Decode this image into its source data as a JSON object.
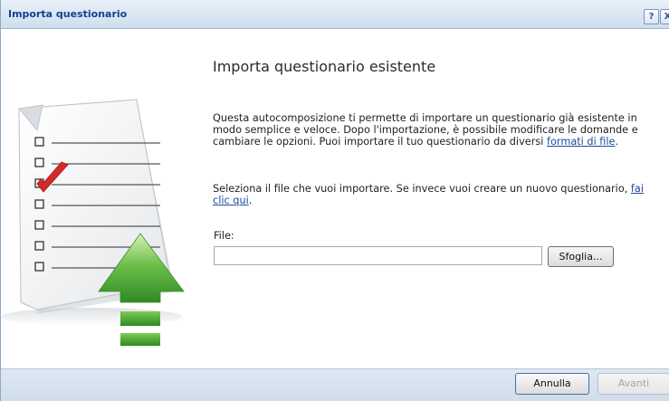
{
  "window": {
    "title": "Importa questionario",
    "help_label": "?",
    "close_label": "X"
  },
  "main": {
    "heading": "Importa questionario esistente",
    "paragraph1_text": "Questa autocomposizione ti permette di importare un questionario già esistente in modo semplice e veloce. Dopo l'importazione, è possibile modificare le domande e cambiare le opzioni. Puoi importare il tuo questionario da diversi ",
    "paragraph1_link": "formati di file",
    "paragraph1_end": ".",
    "paragraph2_text": "Seleziona il file che vuoi importare. Se invece vuoi creare un nuovo questionario, ",
    "paragraph2_link": "fai clic qui",
    "paragraph2_end": ".",
    "file_label": "File:",
    "file_value": "",
    "browse_label": "Sfoglia..."
  },
  "footer": {
    "cancel_label": "Annulla",
    "next_label": "Avanti"
  },
  "illustration": {
    "icon": "import-questionnaire-icon",
    "checkbox_count": 7,
    "checked_index": 2
  },
  "colors": {
    "title_text": "#15428b",
    "arrow_green": "#3f9c2e",
    "check_red": "#d42a2a",
    "link": "#1a4aa0"
  }
}
